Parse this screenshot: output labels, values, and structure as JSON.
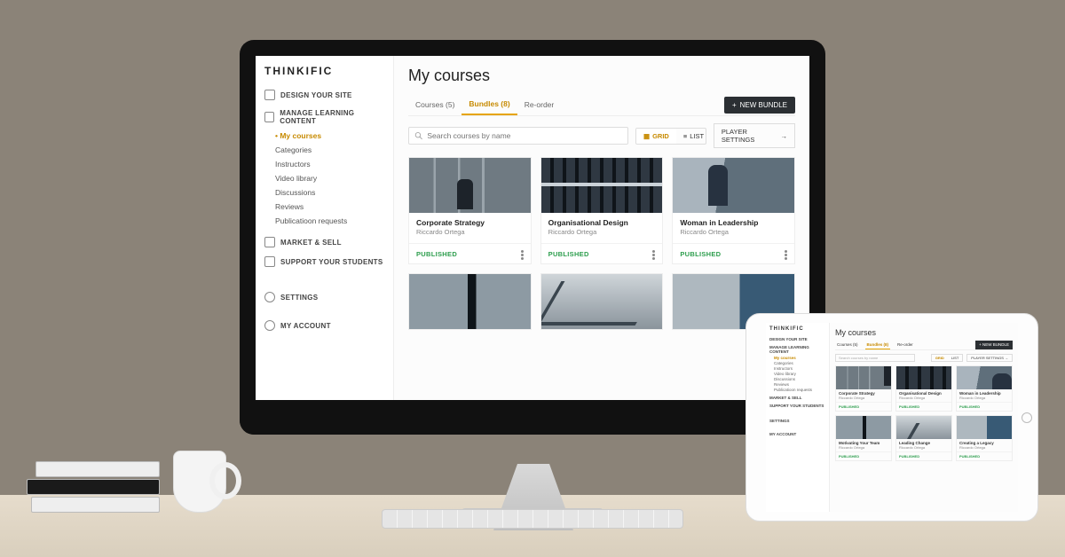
{
  "brand": "THINKIFIC",
  "page_title": "My courses",
  "sidebar": {
    "sections": [
      {
        "label": "DESIGN YOUR SITE"
      },
      {
        "label": "MANAGE LEARNING CONTENT",
        "items": [
          "My courses",
          "Categories",
          "Instructors",
          "Video library",
          "Discussions",
          "Reviews",
          "Publicatioon requests"
        ],
        "active_index": 0
      },
      {
        "label": "MARKET & SELL"
      },
      {
        "label": "SUPPORT YOUR STUDENTS"
      },
      {
        "label": "SETTINGS"
      },
      {
        "label": "MY ACCOUNT"
      }
    ]
  },
  "tabs": [
    {
      "label": "Courses (5)",
      "active": false
    },
    {
      "label": "Bundles (8)",
      "active": true
    },
    {
      "label": "Re-order",
      "active": false
    }
  ],
  "new_button": "NEW BUNDLE",
  "search_placeholder": "Search courses by name",
  "view": {
    "grid": "GRID",
    "list": "LIST",
    "active": "grid"
  },
  "player_settings": "PLAYER SETTINGS",
  "status_label": "PUBLISHED",
  "cards": [
    {
      "title": "Corporate Strategy",
      "author": "Riccardo Ortega",
      "thumb": "a"
    },
    {
      "title": "Organisational Design",
      "author": "Riccardo Ortega",
      "thumb": "b"
    },
    {
      "title": "Woman in Leadership",
      "author": "Riccardo Ortega",
      "thumb": "c"
    },
    {
      "title": "",
      "author": "",
      "thumb": "d",
      "cut": true
    },
    {
      "title": "",
      "author": "",
      "thumb": "e",
      "cut": true
    },
    {
      "title": "",
      "author": "",
      "thumb": "f",
      "cut": true
    }
  ],
  "tablet": {
    "cards": [
      {
        "title": "Corporate Strategy",
        "author": "Riccardo Ortega",
        "thumb": "a"
      },
      {
        "title": "Organisational Design",
        "author": "Riccardo Ortega",
        "thumb": "b"
      },
      {
        "title": "Woman in Leadership",
        "author": "Riccardo Ortega",
        "thumb": "c"
      },
      {
        "title": "Motivating Your Team",
        "author": "Riccardo Ortega",
        "thumb": "d"
      },
      {
        "title": "Leading Change",
        "author": "Riccardo Ortega",
        "thumb": "e"
      },
      {
        "title": "Creating a Legacy",
        "author": "Riccardo Ortega",
        "thumb": "f"
      }
    ]
  }
}
